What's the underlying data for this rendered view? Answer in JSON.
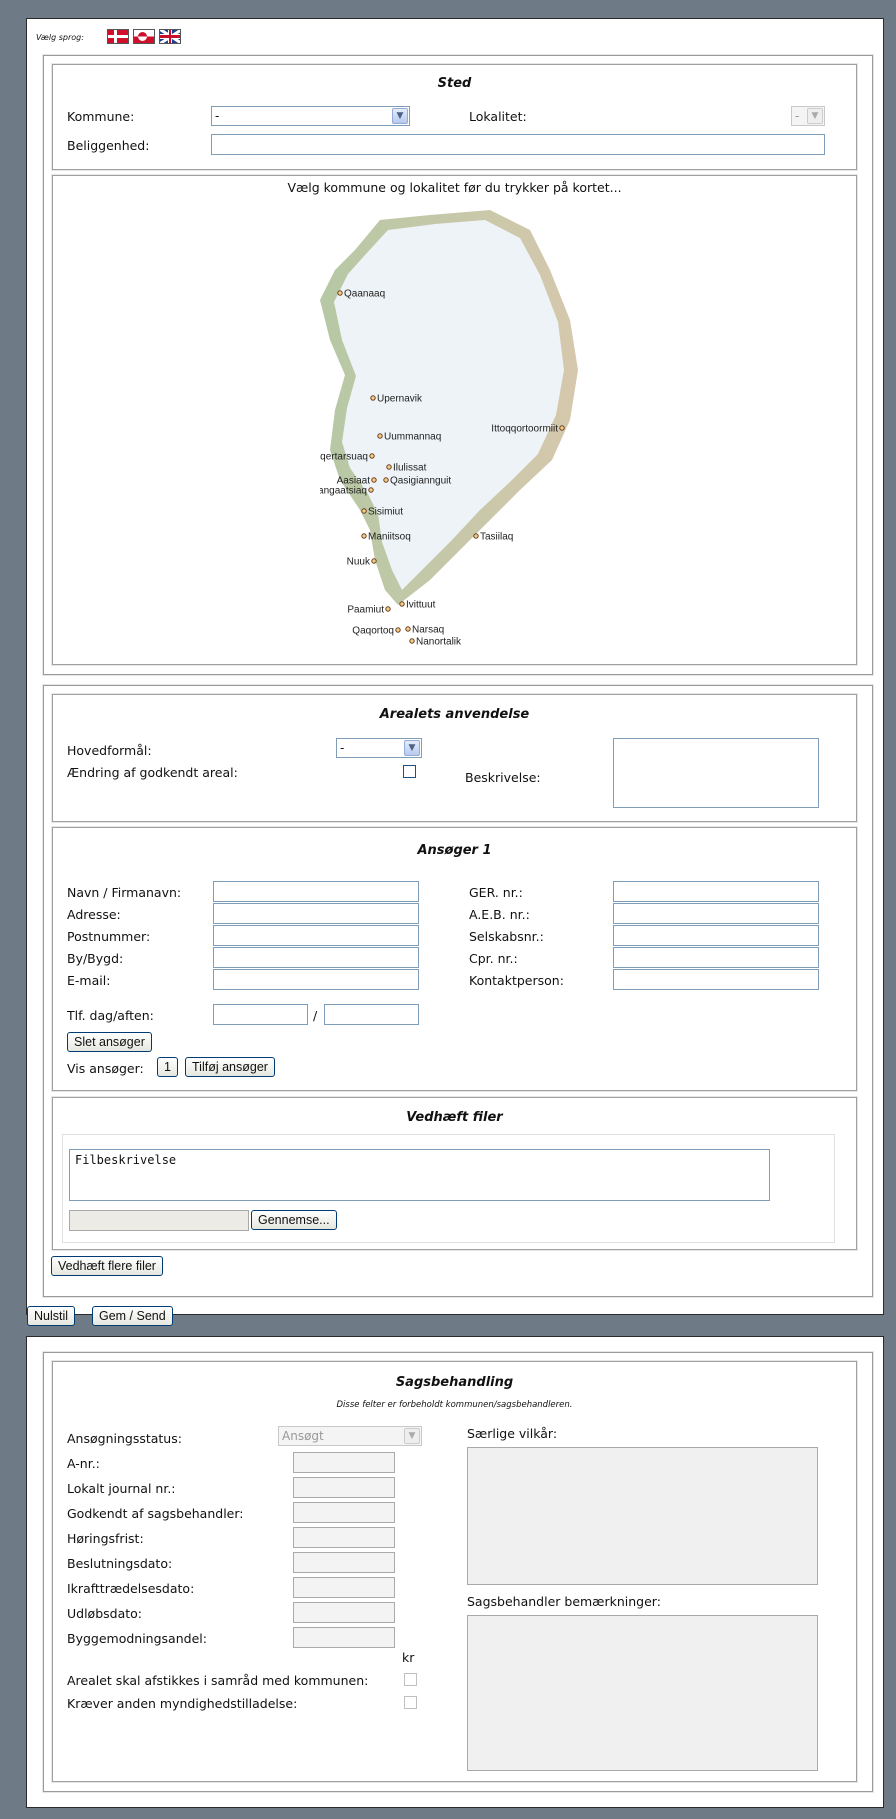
{
  "language": {
    "label": "Vælg sprog:",
    "flags": [
      "danish-flag-icon",
      "greenlandic-flag-icon",
      "uk-flag-icon"
    ]
  },
  "sted": {
    "title": "Sted",
    "kommune_label": "Kommune:",
    "kommune_value": "-",
    "lokalitet_label": "Lokalitet:",
    "lokalitet_value": "-",
    "beliggenhed_label": "Beliggenhed:",
    "beliggenhed_value": ""
  },
  "map": {
    "instruction": "Vælg kommune og lokalitet før du trykker på kortet...",
    "places": [
      "Qaanaaq",
      "Upernavik",
      "Uummannaq",
      "Ittoqqortoormiit",
      "Qeqertarsuaq",
      "Ilulissat",
      "Aasiaat",
      "Qasigiannguit",
      "Kangaatsiaq",
      "Sisimiut",
      "Maniitsoq",
      "Tasiilaq",
      "Nuuk",
      "Paamiut",
      "Ivittuut",
      "Narsaq",
      "Qaqortoq",
      "Nanortalik"
    ]
  },
  "anvendelse": {
    "title": "Arealets anvendelse",
    "hovedformaal_label": "Hovedformål:",
    "hovedformaal_value": "-",
    "aendring_label": "Ændring af godkendt areal:",
    "beskrivelse_label": "Beskrivelse:"
  },
  "ansoger": {
    "title": "Ansøger 1",
    "left_fields": [
      "Navn / Firmanavn:",
      "Adresse:",
      "Postnummer:",
      "By/Bygd:",
      "E-mail:"
    ],
    "phone_label": "Tlf. dag/aften:",
    "phone_separator": "/",
    "right_fields": [
      "GER. nr.:",
      "A.E.B. nr.:",
      "Selskabsnr.:",
      "Cpr. nr.:",
      "Kontaktperson:"
    ],
    "delete_button": "Slet ansøger",
    "vis_label": "Vis ansøger:",
    "page_button": "1",
    "add_button": "Tilføj ansøger"
  },
  "files": {
    "title": "Vedhæft filer",
    "description_value": "Filbeskrivelse",
    "browse_button": "Gennemse...",
    "more_button": "Vedhæft flere filer"
  },
  "actions": {
    "reset": "Nulstil",
    "save": "Gem / Send"
  },
  "sagsbehandling": {
    "title": "Sagsbehandling",
    "subtitle": "Disse felter er forbeholdt kommunen/sagsbehandleren.",
    "status_label": "Ansøgningsstatus:",
    "status_value": "Ansøgt",
    "fields": [
      "A-nr.:",
      "Lokalt journal nr.:",
      "Godkendt af sagsbehandler:",
      "Høringsfrist:",
      "Beslutningsdato:",
      "Ikrafttrædelsesdato:",
      "Udløbsdato:",
      "Byggemodningsandel:"
    ],
    "currency": "kr",
    "checkbox1_label": "Arealet skal afstikkes i samråd med kommunen:",
    "checkbox2_label": "Kræver anden myndighedstilladelse:",
    "vilkaar_label": "Særlige vilkår:",
    "bemaerkninger_label": "Sagsbehandler bemærkninger:"
  }
}
